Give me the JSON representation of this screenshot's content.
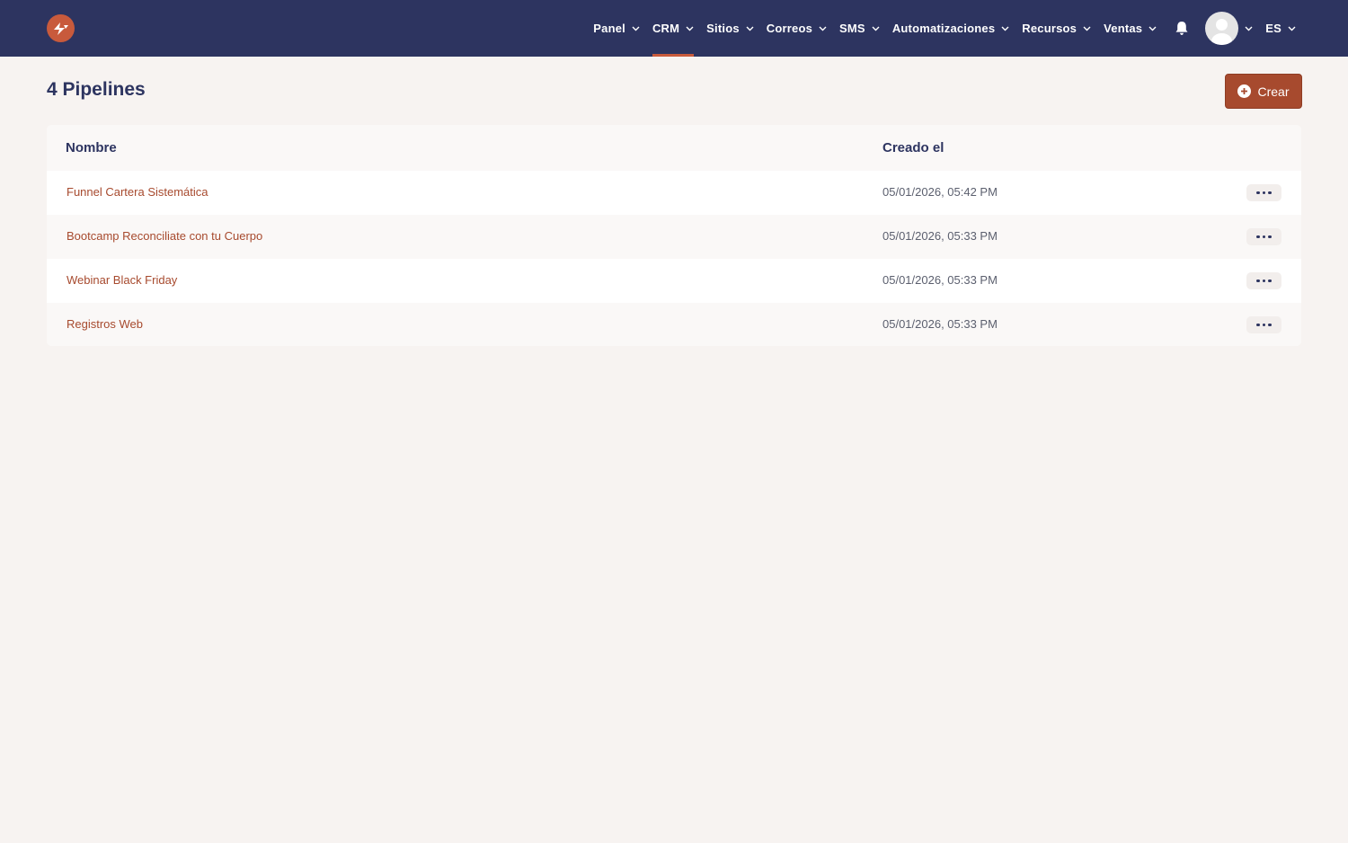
{
  "nav": {
    "items": [
      {
        "label": "Panel",
        "active": false
      },
      {
        "label": "CRM",
        "active": true
      },
      {
        "label": "Sitios",
        "active": false
      },
      {
        "label": "Correos",
        "active": false
      },
      {
        "label": "SMS",
        "active": false
      },
      {
        "label": "Automatizaciones",
        "active": false
      },
      {
        "label": "Recursos",
        "active": false
      },
      {
        "label": "Ventas",
        "active": false
      }
    ],
    "language": "ES"
  },
  "page": {
    "title": "4 Pipelines",
    "create_label": "Crear"
  },
  "table": {
    "headers": {
      "name": "Nombre",
      "created": "Creado el"
    },
    "rows": [
      {
        "name": "Funnel Cartera Sistemática",
        "created": "05/01/2026, 05:42 PM"
      },
      {
        "name": "Bootcamp Reconciliate con tu Cuerpo",
        "created": "05/01/2026, 05:33 PM"
      },
      {
        "name": "Webinar Black Friday",
        "created": "05/01/2026, 05:33 PM"
      },
      {
        "name": "Registros Web",
        "created": "05/01/2026, 05:33 PM"
      }
    ]
  },
  "colors": {
    "nav_bg": "#2d3460",
    "accent": "#c85a3c",
    "button_bg": "#a74a2e",
    "page_bg": "#f7f3f1"
  }
}
